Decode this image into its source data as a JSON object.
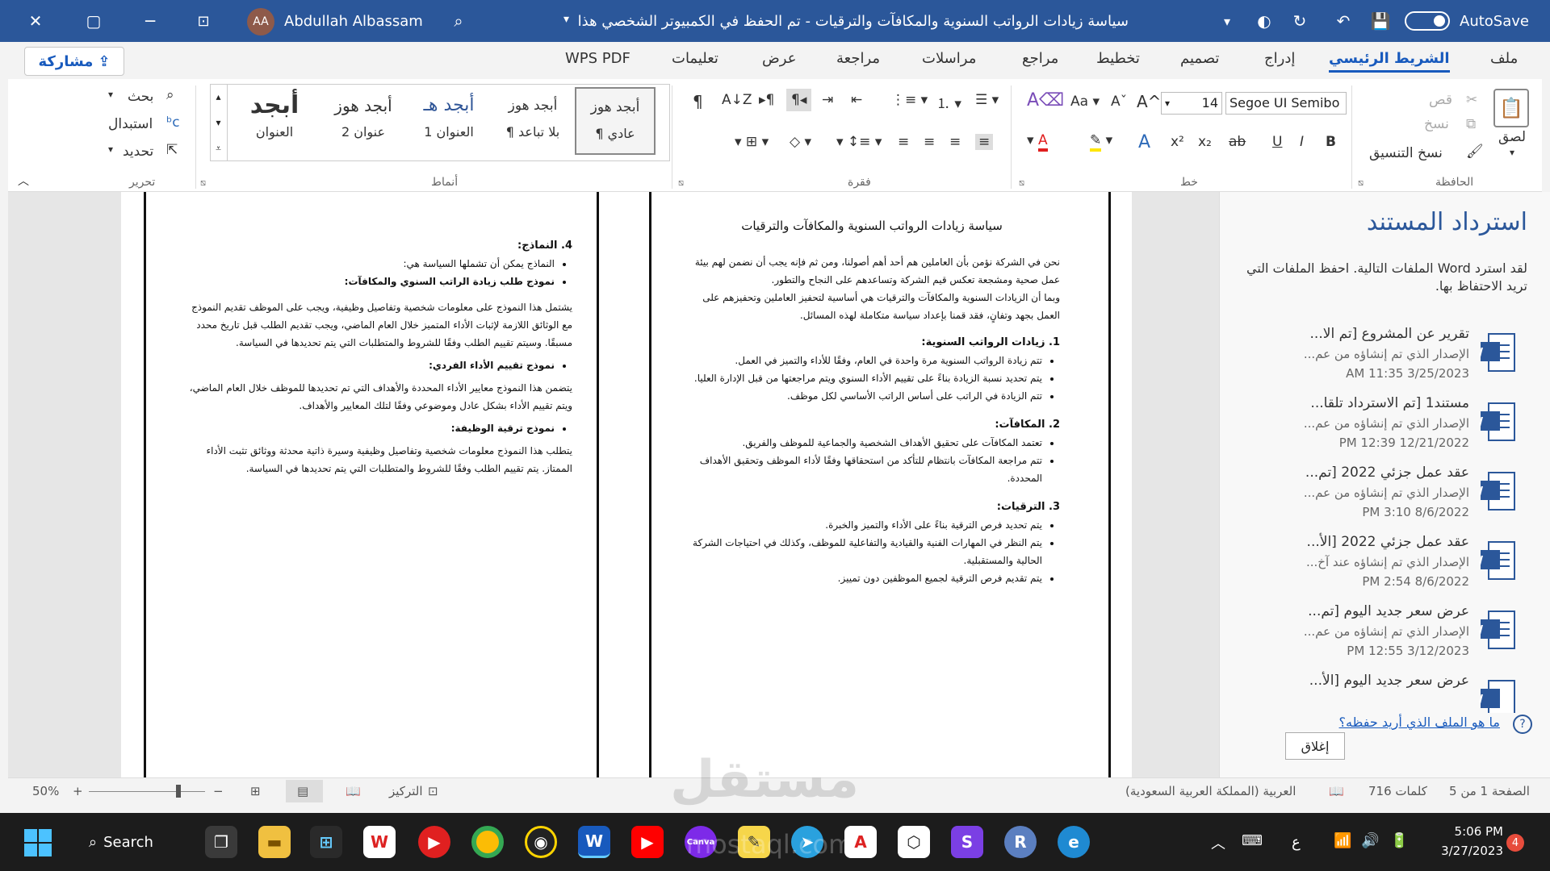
{
  "titlebar": {
    "user": "Abdullah Albassam",
    "avatar": "AA",
    "doc_title": "سياسة زيادات الرواتب السنوية والمكافآت والترقيات - تم الحفظ في الكمبيوتر الشخصي هذا",
    "autosave": "AutoSave"
  },
  "tabs": [
    {
      "label": "ملف"
    },
    {
      "label": "الشريط الرئيسي"
    },
    {
      "label": "إدراج"
    },
    {
      "label": "تصميم"
    },
    {
      "label": "تخطيط"
    },
    {
      "label": "مراجع"
    },
    {
      "label": "مراسلات"
    },
    {
      "label": "مراجعة"
    },
    {
      "label": "عرض"
    },
    {
      "label": "تعليمات"
    },
    {
      "label": "WPS PDF"
    }
  ],
  "share_label": "مشاركة",
  "ribbon": {
    "clipboard": {
      "paste": "لصق",
      "cut": "قص",
      "copy": "نسخ",
      "format_painter": "نسخ التنسيق",
      "group": "الحافظة"
    },
    "font": {
      "name": "Segoe UI Semibo",
      "size": "14",
      "group": "خط",
      "aa": "Aa",
      "bold": "B",
      "italic": "I",
      "underline": "U",
      "strike": "ab",
      "sub": "x₂",
      "sup": "x²"
    },
    "paragraph": {
      "group": "فقرة"
    },
    "styles": {
      "group": "أنماط",
      "items": [
        {
          "sample": "أبجد هوز",
          "name": "¶ عادي"
        },
        {
          "sample": "أبجد هوز",
          "name": "¶ بلا تباعد"
        },
        {
          "sample": "أبجد هـ",
          "name": "العنوان 1"
        },
        {
          "sample": "أبجد هوز",
          "name": "عنوان 2"
        },
        {
          "sample": "أبجد",
          "name": "العنوان"
        }
      ]
    },
    "editing": {
      "find": "بحث",
      "replace": "استبدال",
      "select": "تحديد",
      "group": "تحرير"
    }
  },
  "document": {
    "title": "سياسة زيادات الرواتب السنوية والمكافآت والترقيات",
    "intro": "نحن في الشركة نؤمن بأن العاملين هم أحد أهم أصولنا، ومن ثم فإنه يجب أن نضمن لهم بيئة عمل صحية ومشجعة تعكس قيم الشركة وتساعدهم على النجاح والتطور.",
    "intro2": "وبما أن الزيادات السنوية والمكافآت والترقيات هي أساسية لتحفيز العاملين وتحفيزهم على العمل بجهد وتفانٍ، فقد قمنا بإعداد سياسة متكاملة لهذه المسائل.",
    "s1": {
      "title": "1. زيادات الرواتب السنوية:",
      "items": [
        "تتم زيادة الرواتب السنوية مرة واحدة في العام، وفقًا للأداء والتميز في العمل.",
        "يتم تحديد نسبة الزيادة بناءً على تقييم الأداء السنوي ويتم مراجعتها من قبل الإدارة العليا.",
        "تتم الزيادة في الراتب على أساس الراتب الأساسي لكل موظف."
      ]
    },
    "s2": {
      "title": "2. المكافآت:",
      "items": [
        "تعتمد المكافآت على تحقيق الأهداف الشخصية والجماعية للموظف والفريق.",
        "تتم مراجعة المكافآت بانتظام للتأكد من استحقاقها وفقًا لأداء الموظف وتحقيق الأهداف المحددة."
      ]
    },
    "s3": {
      "title": "3. الترقيات:",
      "items": [
        "يتم تحديد فرص الترقية بناءً على الأداء والتميز والخبرة.",
        "يتم النظر في المهارات الفنية والقيادية والتفاعلية للموظف، وكذلك في احتياجات الشركة الحالية والمستقبلية.",
        "يتم تقديم فرص الترقية لجميع الموظفين دون تمييز."
      ]
    },
    "s4": {
      "title": "4. النماذج:",
      "items": [
        "النماذج يمكن أن تشملها السياسة هي:",
        "نموذج طلب زيادة الراتب السنوي والمكافآت:"
      ]
    },
    "p_form1": "يشتمل هذا النموذج على معلومات شخصية وتفاصيل وظيفية، ويجب على الموظف تقديم النموذج مع الوثائق اللازمة لإثبات الأداء المتميز خلال العام الماضي، ويجب تقديم الطلب قبل تاريخ محدد مسبقًا. وسيتم تقييم الطلب وفقًا للشروط والمتطلبات التي يتم تحديدها في السياسة.",
    "form2_title": "نموذج تقييم الأداء الفردي:",
    "p_form2": "يتضمن هذا النموذج معايير الأداء المحددة والأهداف التي تم تحديدها للموظف خلال العام الماضي، ويتم تقييم الأداء بشكل عادل وموضوعي وفقًا لتلك المعايير والأهداف.",
    "form3_title": "نموذج ترقية الوظيفة:",
    "p_form3": "يتطلب هذا النموذج معلومات شخصية وتفاصيل وظيفية وسيرة ذاتية محدثة ووثائق تثبت الأداء الممتاز. يتم تقييم الطلب وفقًا للشروط والمتطلبات التي يتم تحديدها في السياسة."
  },
  "recovery": {
    "title": "استرداد المستند",
    "desc": "لقد استرد Word الملفات التالية. احفظ الملفات التي تريد الاحتفاظ بها.",
    "items": [
      {
        "title": "تقرير عن المشروع  [تم الا...",
        "desc": "الإصدار الذي تم إنشاؤه من عم...",
        "date": "3/25/2023 11:35 AM"
      },
      {
        "title": "مستند1  [تم الاسترداد تلقا...",
        "desc": "الإصدار الذي تم إنشاؤه من عم...",
        "date": "12/21/2022 12:39 PM"
      },
      {
        "title": "عقد عمل جزئي 2022  [تم...",
        "desc": "الإصدار الذي تم إنشاؤه من عم...",
        "date": "8/6/2022 3:10 PM"
      },
      {
        "title": "عقد عمل جزئي 2022  [الأ...",
        "desc": "الإصدار الذي تم إنشاؤه عند آخ...",
        "date": "8/6/2022 2:54 PM"
      },
      {
        "title": "عرض سعر جديد اليوم  [تم...",
        "desc": "الإصدار الذي تم إنشاؤه من عم...",
        "date": "3/12/2023 12:55 PM"
      },
      {
        "title": "عرض سعر جديد اليوم  [الأ...",
        "desc": "",
        "date": ""
      }
    ],
    "help_link": "ما هو الملف الذي أريد حفظه؟",
    "close": "إغلاق"
  },
  "status": {
    "page": "الصفحة 1 من 5",
    "words": "716 كلمات",
    "language": "العربية (المملكة العربية السعودية)",
    "focus": "التركيز",
    "zoom": "50%"
  },
  "taskbar": {
    "search": "Search",
    "time": "5:06 PM",
    "date": "3/27/2023",
    "lang": "ع",
    "badge": "4",
    "watermark_ar": "مستقل",
    "watermark_en": "mostaql.com"
  },
  "colors": {
    "word_blue": "#2b579a",
    "accent": "#185abd"
  }
}
